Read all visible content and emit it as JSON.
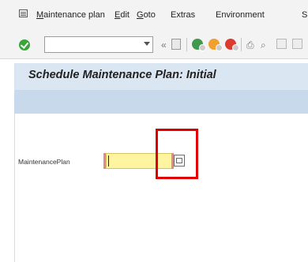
{
  "menu": {
    "items": [
      {
        "underline": "M",
        "rest": "aintenance plan"
      },
      {
        "underline": "E",
        "rest": "dit"
      },
      {
        "underline": "G",
        "rest": "oto"
      },
      {
        "underline": "",
        "rest": "Extras"
      },
      {
        "underline": "",
        "rest": "Environment"
      }
    ],
    "overflow": "S"
  },
  "toolbar": {
    "command_value": "",
    "back_glyph": "«",
    "print_glyph": "⎙",
    "find_glyph": "⌕",
    "icon_colors": {
      "enter": "#3aa53a",
      "back_nav": "#3f9a4f",
      "exit_nav": "#f0a030",
      "cancel_nav": "#dd3b2e"
    }
  },
  "title": "Schedule Maintenance Plan: Initial",
  "form": {
    "maintenance_plan_label": "MaintenancePlan",
    "maintenance_plan_value": ""
  },
  "highlight_color": "#e00000"
}
